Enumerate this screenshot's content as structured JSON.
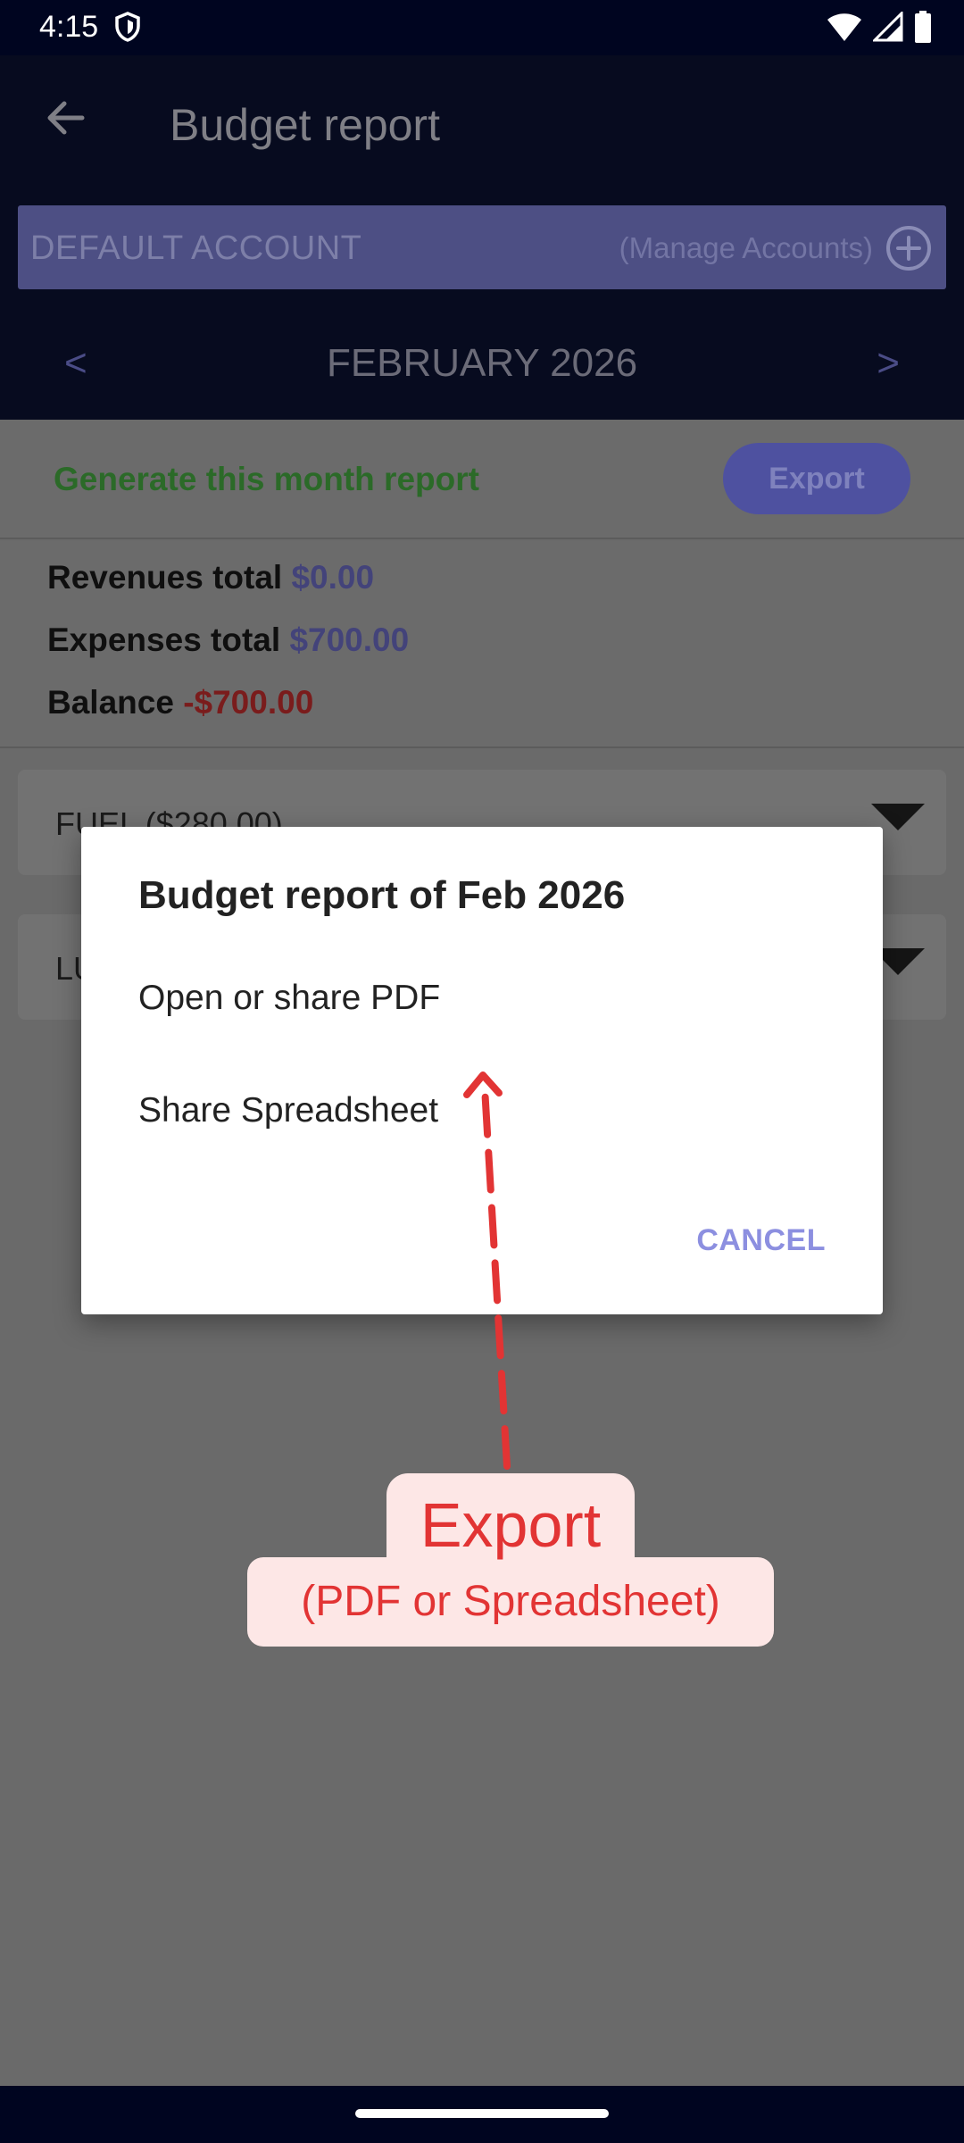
{
  "status_bar": {
    "time": "4:15",
    "icons": [
      "shield-icon",
      "wifi-icon",
      "signal-icon",
      "battery-icon"
    ]
  },
  "app_bar": {
    "title": "Budget report",
    "back_icon": "arrow-back-icon"
  },
  "account": {
    "name": "DEFAULT ACCOUNT",
    "manage_label": "(Manage Accounts)",
    "add_icon": "add-circle-icon"
  },
  "month_nav": {
    "prev": "<",
    "label": "FEBRUARY 2026",
    "next": ">"
  },
  "report_header": {
    "generate_label": "Generate this month report",
    "export_label": "Export"
  },
  "totals": {
    "revenues_label": "Revenues total",
    "revenues_value": "$0.00",
    "expenses_label": "Expenses total",
    "expenses_value": "$700.00",
    "balance_label": "Balance",
    "balance_value": "-$700.00"
  },
  "categories": [
    {
      "label": "FUEL ($280.00)"
    },
    {
      "label": "LU"
    }
  ],
  "dialog": {
    "title": "Budget report of Feb 2026",
    "items": [
      "Open or share PDF",
      "Share Spreadsheet"
    ],
    "cancel": "CANCEL"
  },
  "annotation": {
    "title": "Export",
    "subtitle": "(PDF or Spreadsheet)",
    "color": "#e23434"
  },
  "colors": {
    "app_bar": "#070b1f",
    "accent": "#8c8fe0",
    "green": "#2b6a28",
    "negative": "#7a1c1c"
  }
}
